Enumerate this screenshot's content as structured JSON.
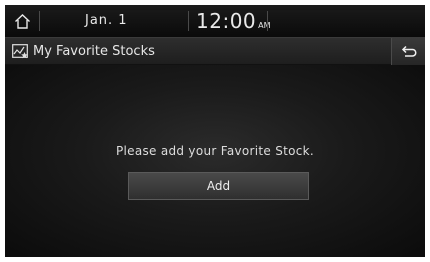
{
  "status_bar": {
    "home_icon": "home-icon",
    "date": "Jan. 1",
    "time": "12:00",
    "ampm": "AM"
  },
  "title_bar": {
    "icon": "stock-chart-star-icon",
    "title": "My Favorite Stocks",
    "back_icon": "back-icon"
  },
  "main": {
    "message": "Please add your Favorite Stock.",
    "add_label": "Add"
  }
}
